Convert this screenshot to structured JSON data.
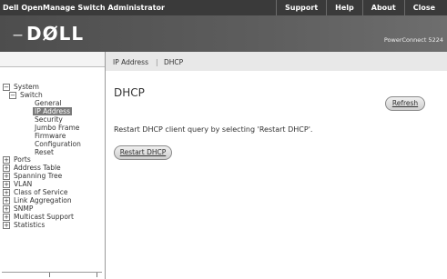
{
  "header": {
    "app_title": "Dell OpenManage Switch Administrator",
    "links": [
      "Support",
      "Help",
      "About",
      "Close"
    ],
    "logo_text": "DØLL",
    "model": "PowerConnect 5224"
  },
  "tree": {
    "items": [
      {
        "label": "System",
        "toggle": "−"
      },
      {
        "label": "Switch",
        "toggle": "−"
      },
      {
        "label": "General"
      },
      {
        "label": "IP Address"
      },
      {
        "label": "Security"
      },
      {
        "label": "Jumbo Frame"
      },
      {
        "label": "Firmware"
      },
      {
        "label": "Configuration"
      },
      {
        "label": "Reset"
      },
      {
        "label": "Ports",
        "toggle": "+"
      },
      {
        "label": "Address Table",
        "toggle": "+"
      },
      {
        "label": "Spanning Tree",
        "toggle": "+"
      },
      {
        "label": "VLAN",
        "toggle": "+"
      },
      {
        "label": "Class of Service",
        "toggle": "+"
      },
      {
        "label": "Link Aggregation",
        "toggle": "+"
      },
      {
        "label": "SNMP",
        "toggle": "+"
      },
      {
        "label": "Multicast Support",
        "toggle": "+"
      },
      {
        "label": "Statistics",
        "toggle": "+"
      }
    ]
  },
  "breadcrumb": {
    "items": [
      "IP Address",
      "DHCP"
    ],
    "separator": "|"
  },
  "main": {
    "title": "DHCP",
    "refresh_label": "Refresh",
    "info_text": "Restart DHCP client query by selecting 'Restart DHCP'.",
    "restart_label": "Restart DHCP"
  }
}
